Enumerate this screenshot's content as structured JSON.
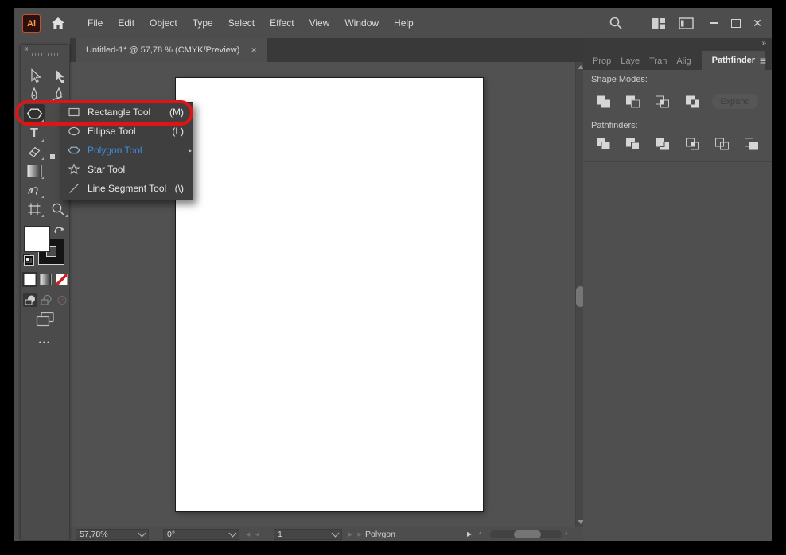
{
  "titlebar": {
    "app_icon_label": "Ai",
    "menu_items": [
      "File",
      "Edit",
      "Object",
      "Type",
      "Select",
      "Effect",
      "View",
      "Window",
      "Help"
    ]
  },
  "document_tab": {
    "label": "Untitled-1* @ 57,78 % (CMYK/Preview)",
    "close": "✕"
  },
  "toolbar": {
    "tools": [
      "selection-tool",
      "direct-selection-tool",
      "pen-tool",
      "curvature-tool",
      "shape-tool",
      "type-tool",
      "eraser-tool",
      "gradient-tool",
      "shaper-tool",
      "artboard-tool",
      "zoom-tool"
    ],
    "active_tool": "shape-tool"
  },
  "flyout_menu": {
    "items": [
      {
        "label": "Rectangle Tool",
        "shortcut": "(M)"
      },
      {
        "label": "Ellipse Tool",
        "shortcut": "(L)"
      },
      {
        "label": "Polygon Tool",
        "shortcut": ""
      },
      {
        "label": "Star Tool",
        "shortcut": ""
      },
      {
        "label": "Line Segment Tool",
        "shortcut": "(\\)"
      }
    ],
    "active_item": "Polygon Tool"
  },
  "annotation": {
    "shape": "red-oval",
    "color": "#e01414",
    "target": "Rectangle Tool"
  },
  "right_dock": {
    "tabs": [
      "Prop",
      "Laye",
      "Tran",
      "Alig",
      "Pathfinder"
    ],
    "active_tab": "Pathfinder",
    "pathfinder_panel": {
      "shape_modes_label": "Shape Modes:",
      "expand_button_label": "Expand",
      "pathfinders_label": "Pathfinders:"
    }
  },
  "status_bar": {
    "zoom_value": "57,78%",
    "rotation_value": "0°",
    "artboard_value": "1",
    "current_tool": "Polygon"
  },
  "icons": {
    "titlebar_icons": [
      "search-icon",
      "workspace-switcher-icon",
      "arrange-documents-icon"
    ],
    "window_icons": [
      "minimize-icon",
      "restore-icon",
      "close-icon"
    ],
    "shape_mode_icons": [
      "unite-icon",
      "minus-front-icon",
      "intersect-icon",
      "exclude-icon"
    ],
    "pathfinder_icons": [
      "divide-icon",
      "trim-icon",
      "merge-icon",
      "crop-icon",
      "outline-icon",
      "minus-back-icon"
    ],
    "type_tool_glyph": "T",
    "ellipsis_glyph": "•••",
    "hamburger_glyph": "≡",
    "collapse_left_glyph": "«",
    "collapse_right_glyph": "»",
    "tearoff_glyph": "▸",
    "prev_glyph": "◀ ◀",
    "next_glyph": "▶ ▶",
    "play_glyph": "▶",
    "scroll_left_glyph": "‹",
    "scroll_right_glyph": "›"
  },
  "colors": {
    "highlight_blue": "#3e8edd",
    "annotation_red": "#e01414",
    "panel_bg": "#4f4f4f",
    "canvas_bg": "#515151"
  }
}
